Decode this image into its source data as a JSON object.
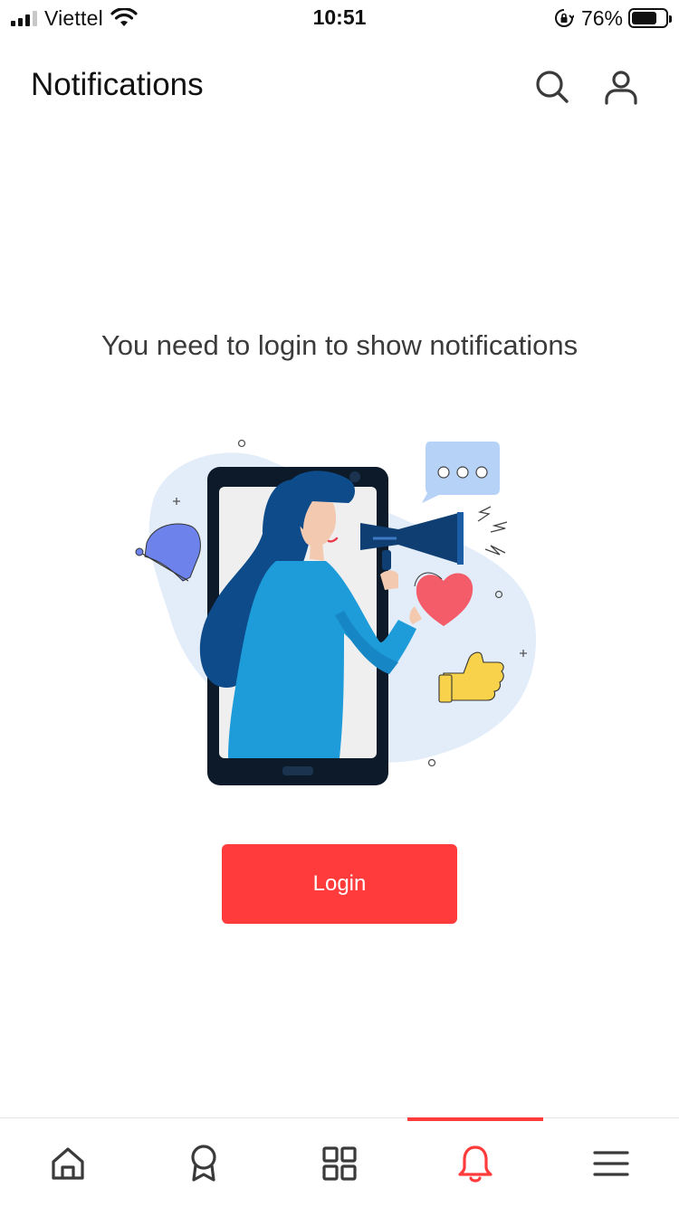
{
  "status_bar": {
    "carrier": "Viettel",
    "time": "10:51",
    "battery_percent": "76%",
    "battery_level": 0.76,
    "signal_bars": 3,
    "icons": [
      "signal-icon",
      "wifi-icon",
      "rotation-lock-icon",
      "battery-icon"
    ]
  },
  "header": {
    "title": "Notifications",
    "icons": [
      "search-icon",
      "user-icon"
    ]
  },
  "main": {
    "message": "You need to login to show notifications",
    "illustration": "woman-with-megaphone-in-phone",
    "login_label": "Login"
  },
  "tabbar": {
    "tabs": [
      {
        "name": "home",
        "icon": "home-icon",
        "active": false
      },
      {
        "name": "rewards",
        "icon": "award-ribbon-icon",
        "active": false
      },
      {
        "name": "apps",
        "icon": "grid-icon",
        "active": false
      },
      {
        "name": "notifications",
        "icon": "bell-icon",
        "active": true
      },
      {
        "name": "menu",
        "icon": "menu-icon",
        "active": false
      }
    ]
  },
  "colors": {
    "accent": "#ff3b3b",
    "text_primary": "#111111",
    "text_secondary": "#3b3b3b",
    "icon_inactive": "#3a3a3a"
  }
}
